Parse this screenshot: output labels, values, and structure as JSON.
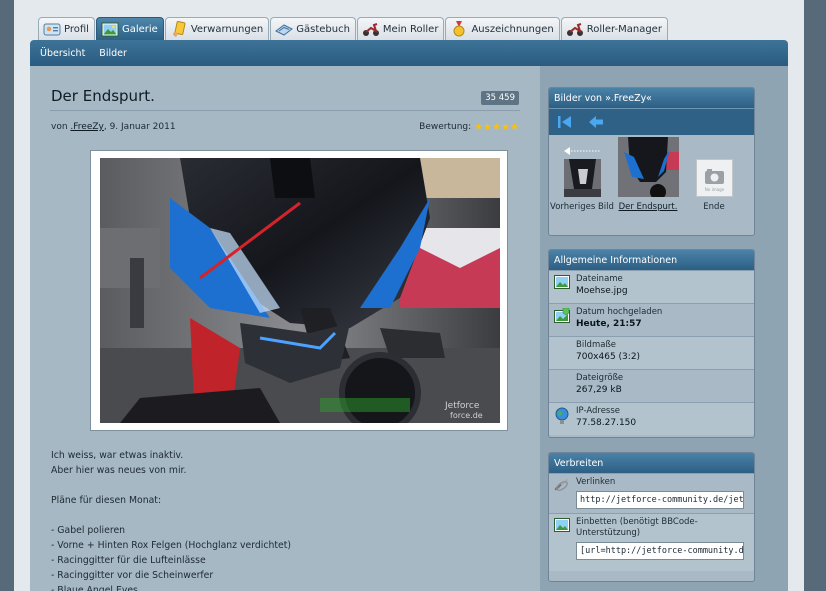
{
  "tabs": [
    {
      "label": "Profil",
      "icon": "profile-card-icon"
    },
    {
      "label": "Galerie",
      "icon": "gallery-image-icon"
    },
    {
      "label": "Verwarnungen",
      "icon": "warning-card-icon"
    },
    {
      "label": "Gästebuch",
      "icon": "guestbook-icon"
    },
    {
      "label": "Mein Roller",
      "icon": "scooter-icon"
    },
    {
      "label": "Auszeichnungen",
      "icon": "medal-icon"
    },
    {
      "label": "Roller-Manager",
      "icon": "scooter-icon"
    }
  ],
  "subnav": [
    "Übersicht",
    "Bilder"
  ],
  "image": {
    "title": "Der Endspurt.",
    "views": "35 459",
    "by_prefix": "von ",
    "author": ".FreeZy",
    "date": ", 9. Januar 2011",
    "rating_label": "Bewertung:",
    "stars": 5,
    "watermark_top": "Jetforce",
    "watermark_bottom": "force.de",
    "description": "Ich weiss, war etwas inaktiv.\nAber hier was neues von mir.\n\nPläne für diesen Monat:\n\n- Gabel polieren\n- Vorne + Hinten Rox Felgen (Hochglanz verdichtet)\n- Racinggitter für die Lufteinlässe\n- Racinggitter vor die Scheinwerfer\n- Blaue Angel Eyes"
  },
  "sidebar": {
    "pictures_title": "Bilder von ».FreeZy«",
    "thumbs": [
      {
        "label": "Vorheriges Bild"
      },
      {
        "label": "Der Endspurt."
      },
      {
        "label": "Ende",
        "placeholder": "No image"
      }
    ],
    "info_title": "Allgemeine Informationen",
    "info": [
      {
        "label": "Dateiname",
        "value": "Moehse.jpg",
        "icon": "image-file-icon"
      },
      {
        "label": "Datum hochgeladen",
        "value": "Heute, 21:57",
        "icon": "upload-date-icon"
      },
      {
        "label": "Bildmaße",
        "value": "700x465 (3:2)",
        "icon": ""
      },
      {
        "label": "Dateigröße",
        "value": "267,29 kB",
        "icon": ""
      },
      {
        "label": "IP-Adresse",
        "value": "77.58.27.150",
        "icon": "globe-icon"
      }
    ],
    "share_title": "Verbreiten",
    "share": [
      {
        "label": "Verlinken",
        "value": "http://jetforce-community.de/jetforce",
        "icon": "link-icon"
      },
      {
        "label": "Einbetten (benötigt BBCode-Unterstützung)",
        "value": "[url=http://jetforce-community.de/jetforce",
        "icon": "embed-image-icon"
      }
    ]
  },
  "colors": {
    "header_blue": "#2d6186",
    "star": "#f5c211",
    "background": "#566a7a"
  }
}
